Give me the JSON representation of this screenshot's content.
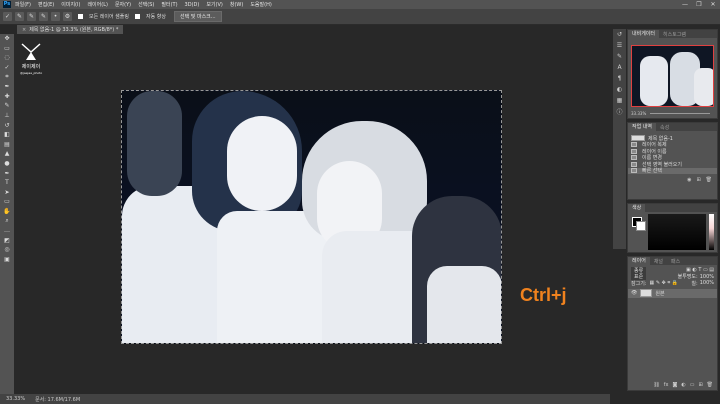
{
  "menubar": {
    "logo": "Ps",
    "items": [
      "파일(F)",
      "편집(E)",
      "이미지(I)",
      "레이어(L)",
      "문자(Y)",
      "선택(S)",
      "필터(T)",
      "3D(D)",
      "보기(V)",
      "창(W)",
      "도움말(H)"
    ]
  },
  "window_controls": [
    "—",
    "❐",
    "✕"
  ],
  "options": {
    "label_all_layers": "모든 레이어 샘플링",
    "label_auto_enhance": "자동 향상",
    "select_mask_button": "선택 및 마스크..."
  },
  "document": {
    "tab_title": "제목 없음-1 @ 33.3% (원본, RGB/8*) *",
    "close": "×"
  },
  "logo": {
    "text_line1": "제이제이",
    "text_line2": "@jaejae_photo"
  },
  "overlay_text": "Ctrl+j",
  "status": {
    "zoom": "33.33%",
    "doc_info": "문서: 17.6M/17.6M"
  },
  "navigator": {
    "tabs": [
      "내비게이터",
      "히스토그램"
    ],
    "zoom": "33.33%"
  },
  "history": {
    "tabs": [
      "작업 내역",
      "속성"
    ],
    "source": "제목 없음-1",
    "items": [
      "레이어 복제",
      "레이어 이름",
      "이름 변경",
      "선택 영역 불러오기",
      "빠른 선택"
    ]
  },
  "color": {
    "tabs": [
      "색상"
    ]
  },
  "layers": {
    "tabs": [
      "레이어",
      "채널",
      "패스"
    ],
    "kind": "종류",
    "blend_mode": "표준",
    "opacity_label": "불투명도:",
    "opacity_value": "100%",
    "lock_label": "잠그기:",
    "fill_label": "칠:",
    "fill_value": "100%",
    "layer_name": "원본"
  },
  "colors": {
    "accent": "#f0821e",
    "panel": "#535353",
    "bg": "#282828"
  }
}
